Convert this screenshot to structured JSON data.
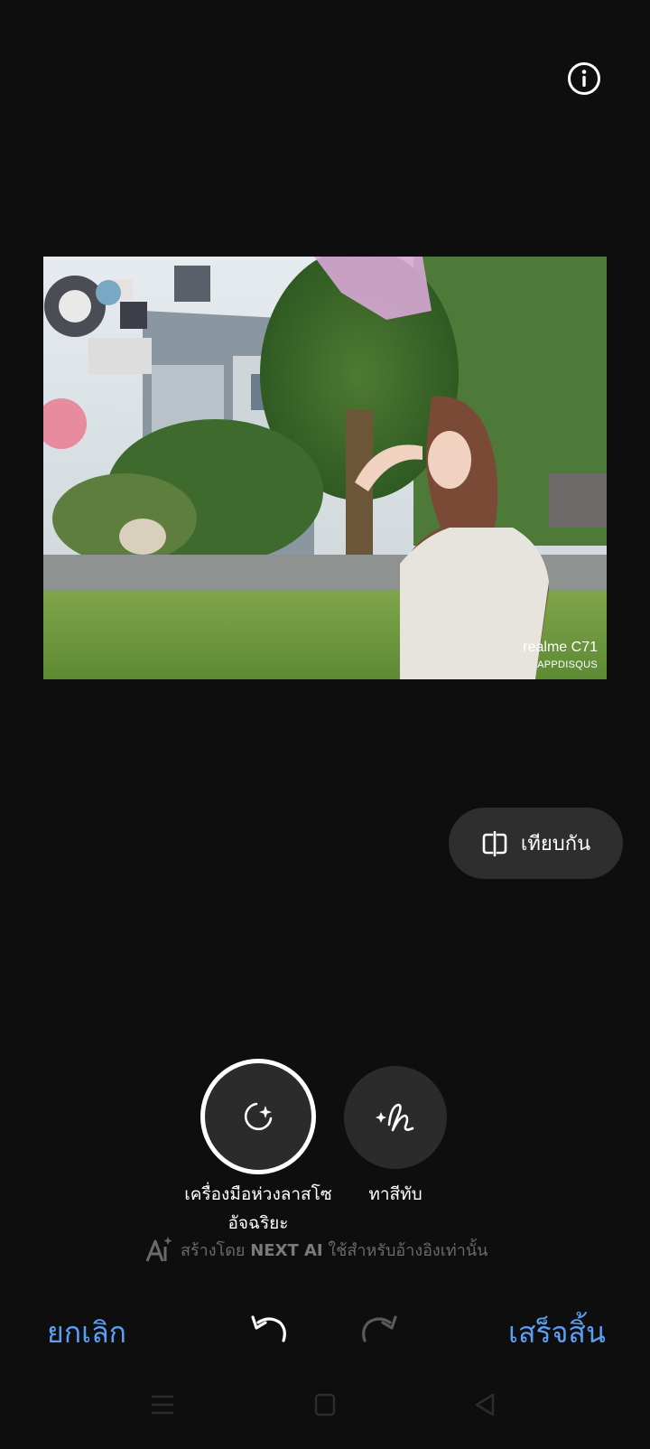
{
  "header": {
    "info_icon": "info-circle-icon"
  },
  "photo": {
    "watermark_model": "realme C71",
    "watermark_source": "APPDISQUS"
  },
  "compare": {
    "label": "เทียบกัน",
    "icon": "compare-split-icon"
  },
  "tools": [
    {
      "label": "เครื่องมือห่วงลาสโซอัจฉริยะ",
      "icon": "smart-lasso-icon",
      "selected": true
    },
    {
      "label": "ทาสีทับ",
      "icon": "sparkle-brush-icon",
      "selected": false
    }
  ],
  "ai_notice": {
    "prefix": "สร้างโดย",
    "brand": "NEXT AI",
    "suffix": "ใช้สำหรับอ้างอิงเท่านั้น"
  },
  "bottom_bar": {
    "cancel_label": "ยกเลิก",
    "done_label": "เสร็จสิ้น"
  },
  "colors": {
    "accent": "#5b9ff5",
    "background": "#0e0e0e",
    "pill": "#2e2e2e"
  }
}
